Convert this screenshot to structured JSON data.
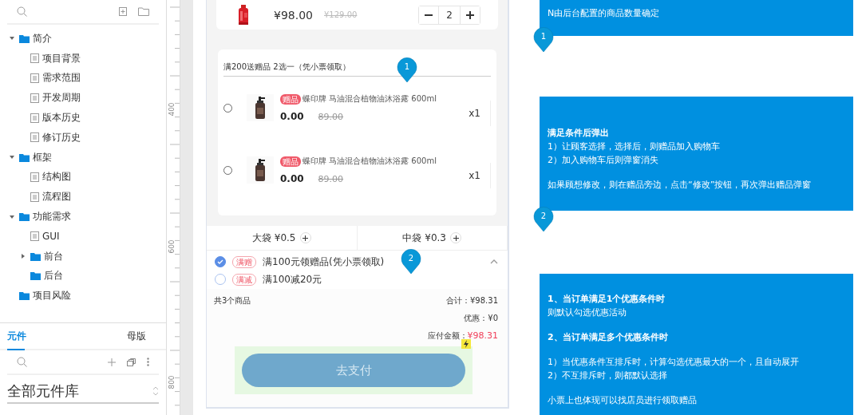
{
  "sidebar": {
    "pages": [
      {
        "label": "简介",
        "kind": "folder",
        "expanded": true,
        "children": [
          {
            "label": "项目背景",
            "kind": "page"
          },
          {
            "label": "需求范围",
            "kind": "page"
          },
          {
            "label": "开发周期",
            "kind": "page"
          },
          {
            "label": "版本历史",
            "kind": "page"
          },
          {
            "label": "修订历史",
            "kind": "page"
          }
        ]
      },
      {
        "label": "框架",
        "kind": "folder",
        "expanded": true,
        "children": [
          {
            "label": "结构图",
            "kind": "page"
          },
          {
            "label": "流程图",
            "kind": "page"
          }
        ]
      },
      {
        "label": "功能需求",
        "kind": "folder",
        "expanded": true,
        "children": [
          {
            "label": "GUI",
            "kind": "page"
          },
          {
            "label": "前台",
            "kind": "folder",
            "expanded": false
          },
          {
            "label": "后台",
            "kind": "folder"
          }
        ]
      },
      {
        "label": "项目风险",
        "kind": "folder"
      }
    ],
    "tabs": [
      {
        "label": "元件",
        "selected": true
      },
      {
        "label": "母版",
        "selected": false
      }
    ],
    "library": {
      "title": "全部元件库"
    }
  },
  "ruler": {
    "marks": [
      "400",
      "600",
      "800"
    ]
  },
  "cart": {
    "product": {
      "price": "¥98.00",
      "original_price": "¥129.00",
      "quantity": "2"
    },
    "gift_panel": {
      "title": "满200送赠品 2选一（凭小票领取）",
      "pin": "1",
      "items": [
        {
          "tag": "赠品",
          "name": "蝶印牌 马油混合植物油沐浴露 600ml",
          "price": "0.00",
          "original_price": "89.00",
          "quantity": "x1",
          "selected": false
        },
        {
          "tag": "赠品",
          "name": "蝶印牌 马油混合植物油沐浴露 600ml",
          "price": "0.00",
          "original_price": "89.00",
          "quantity": "x1",
          "selected": false
        }
      ]
    },
    "bags": [
      {
        "label": "大袋 ¥0.5"
      },
      {
        "label": "中袋 ¥0.3"
      }
    ],
    "promotions": {
      "pin": "2",
      "items": [
        {
          "tag": "满赠",
          "label": "满100元领赠品(凭小票领取)",
          "selected": true
        },
        {
          "tag": "满减",
          "label": "满100减20元",
          "selected": false
        }
      ]
    },
    "summary": {
      "count": "共3个商品",
      "total": "合计：¥98.31",
      "discount": "优惠：¥0",
      "payable_label": "应付金额：",
      "payable": "¥98.31"
    },
    "pay_button": "去支付"
  },
  "notes": [
    {
      "paragraphs": [
        [
          {
            "text": "N由后台配置的商品数量确定",
            "bold": false
          }
        ]
      ]
    },
    {
      "pin": "1",
      "paragraphs": [
        [
          {
            "text": "满足条件后弹出",
            "bold": true
          },
          {
            "text": "1）让顾客选择，选择后，则赠品加入购物车",
            "bold": false
          },
          {
            "text": "2）加入购物车后则弹窗消失",
            "bold": false
          }
        ],
        [
          {
            "text": "如果顾想修改，则在赠品旁边，点击“修改”按钮，再次弹出赠品弹窗",
            "bold": false
          }
        ]
      ]
    },
    {
      "pin": "2",
      "paragraphs": [
        [
          {
            "text": "1、当订单满足1个优惠条件时",
            "bold": true
          },
          {
            "text": "则默认勾选优惠活动",
            "bold": false
          }
        ],
        [
          {
            "text": "2、当订单满足多个优惠条件时",
            "bold": true
          }
        ],
        [
          {
            "text": "1）当优惠条件互排斥时，计算勾选优惠最大的一个，且自动展开",
            "bold": false
          },
          {
            "text": "2）不互排斥时，则都默认选择",
            "bold": false
          }
        ],
        [
          {
            "text": "小票上也体现可以找店员进行领取赠品",
            "bold": false
          }
        ]
      ]
    }
  ]
}
